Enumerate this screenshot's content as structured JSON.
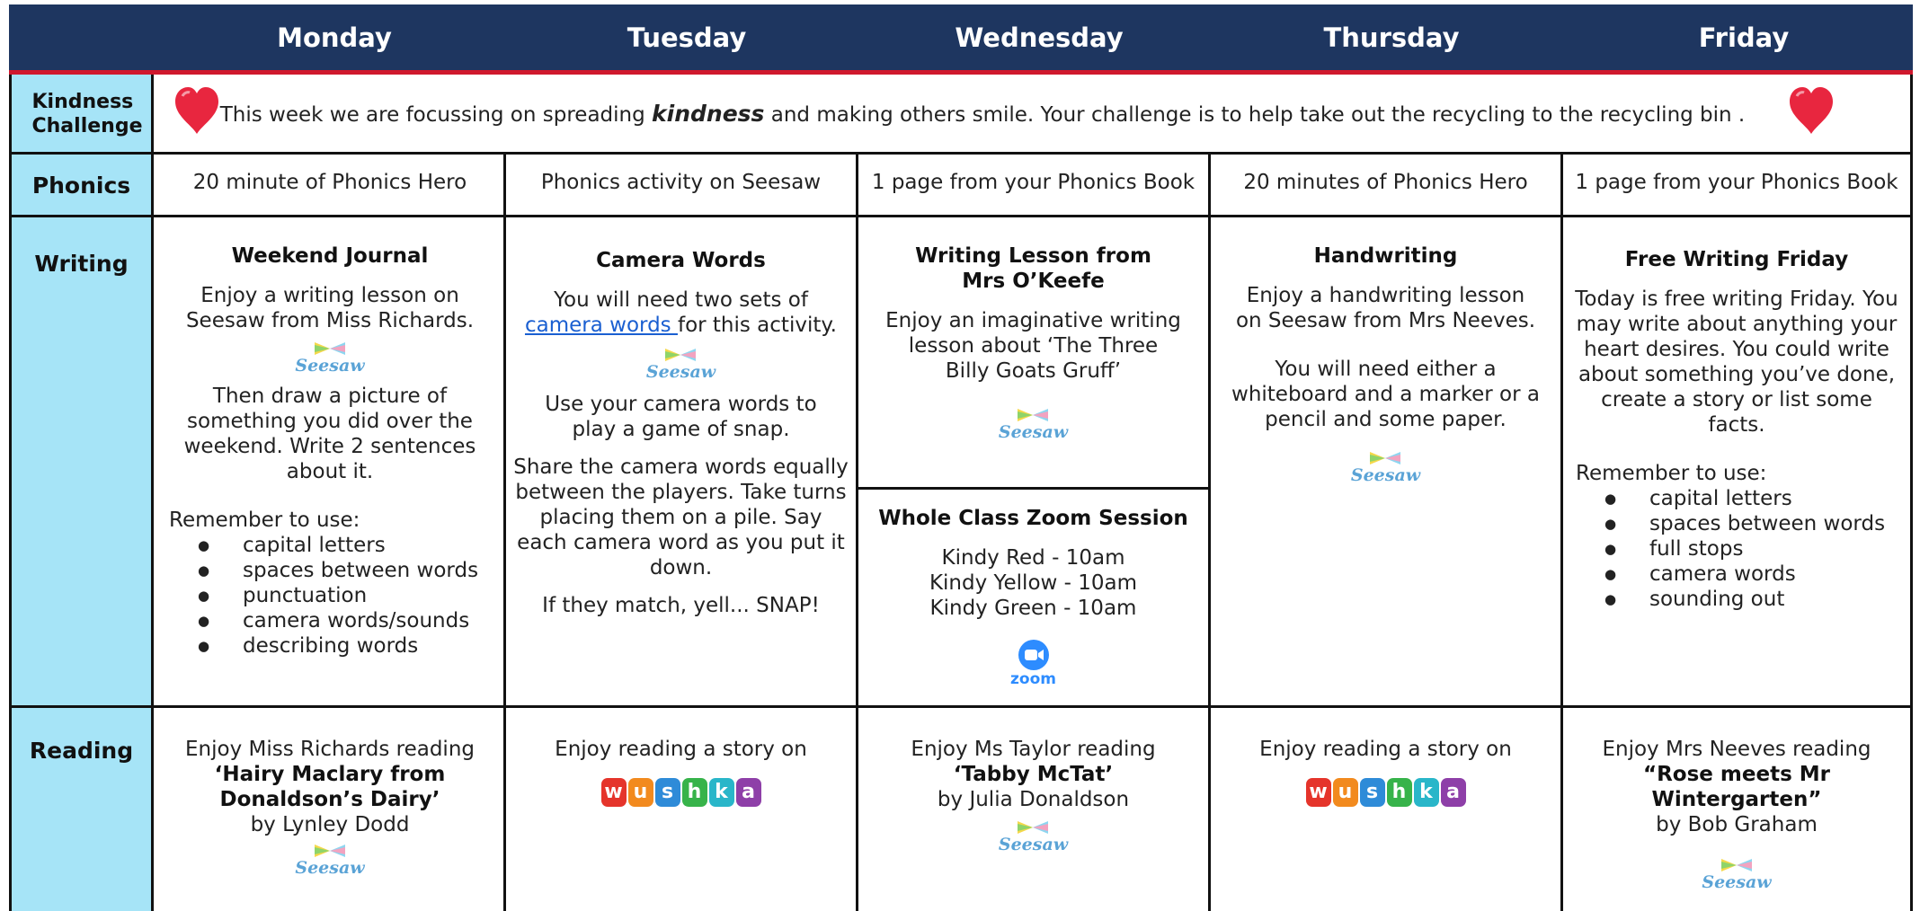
{
  "days": [
    "Monday",
    "Tuesday",
    "Wednesday",
    "Thursday",
    "Friday"
  ],
  "rows": {
    "kindness": "Kindness Challenge",
    "phonics": "Phonics",
    "writing": "Writing",
    "reading": "Reading"
  },
  "kindness": {
    "text_before": "This week we are focussing on spreading ",
    "emphasis": "kindness",
    "text_after": " and making others smile.  Your challenge is to help take out the recycling to the recycling bin ."
  },
  "phonics": [
    "20 minute of Phonics Hero",
    "Phonics activity on Seesaw",
    "1 page from your Phonics Book",
    "20 minutes of Phonics Hero",
    "1 page from your Phonics Book"
  ],
  "writing": {
    "monday": {
      "title": "Weekend Journal",
      "intro": "Enjoy a writing lesson on Seesaw from Miss Richards.",
      "body": "Then draw a picture of something you did over the weekend.  Write 2 sentences about it.",
      "remember": "Remember to use:",
      "bullets": [
        "capital letters",
        "spaces between words",
        "punctuation",
        "camera words/sounds",
        "describing words"
      ]
    },
    "tuesday": {
      "title": "Camera Words",
      "intro_a": "You will need two sets of",
      "link": "camera words ",
      "intro_b": "for this activity.",
      "p1": "Use your camera words to play a game of snap.",
      "p2": "Share the camera words equally between the players. Take turns placing them on a pile. Say each camera word as you put it down.",
      "p3": "If they match, yell... SNAP!"
    },
    "wednesday": {
      "title_1": "Writing Lesson from",
      "title_2": "Mrs O’Keefe",
      "body": "Enjoy an imaginative writing lesson about ‘The Three Billy Goats Gruff’",
      "zoom_title": "Whole Class Zoom Session",
      "sessions": [
        "Kindy Red - 10am",
        "Kindy Yellow - 10am",
        "Kindy Green - 10am"
      ]
    },
    "thursday": {
      "title": "Handwriting",
      "intro": "Enjoy a handwriting lesson on Seesaw from Mrs Neeves.",
      "body": "You will need either a whiteboard and a marker or a pencil and some paper."
    },
    "friday": {
      "title": "Free Writing Friday",
      "body": "Today is free writing Friday. You may write about anything your heart desires. You could write about something you’ve done, create a story or list some facts.",
      "remember": "Remember to use:",
      "bullets": [
        "capital letters",
        "spaces between words",
        "full stops",
        "camera words",
        "sounding out"
      ]
    }
  },
  "reading": {
    "monday": {
      "line1": "Enjoy Miss Richards reading",
      "book": "‘Hairy Maclary from Donaldson’s Dairy’",
      "author": "by Lynley Dodd"
    },
    "tuesday": {
      "line1": "Enjoy reading a story on"
    },
    "wednesday": {
      "line1": "Enjoy Ms Taylor reading",
      "book": "‘Tabby McTat’",
      "author": "by Julia Donaldson"
    },
    "thursday": {
      "line1": "Enjoy reading a story on"
    },
    "friday": {
      "line1": "Enjoy Mrs Neeves reading",
      "book": "“Rose meets Mr Wintergarten”",
      "author": "by Bob Graham"
    }
  },
  "logos": {
    "seesaw": "Seesaw",
    "wushka": [
      "w",
      "u",
      "s",
      "h",
      "k",
      "a"
    ],
    "zoom": "zoom"
  },
  "colors": {
    "header": "#1e3660",
    "header_rule": "#d0182d",
    "row_label": "#a6e4f7",
    "heart": "#e8263f",
    "link": "#1a5fd1"
  }
}
